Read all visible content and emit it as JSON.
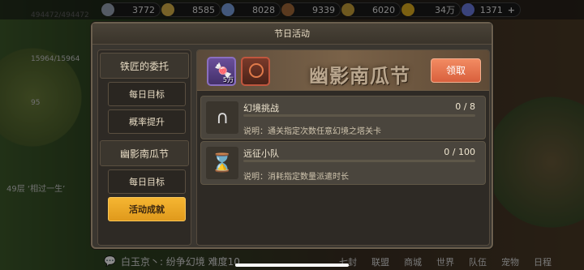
{
  "topbar": {
    "resources": [
      {
        "name": "gem-resource",
        "value": "3772",
        "color": "#9aa4b6"
      },
      {
        "name": "gold-bar-resource",
        "value": "8585",
        "color": "#d9b24a"
      },
      {
        "name": "flower-resource",
        "value": "8028",
        "color": "#7aa0e0"
      },
      {
        "name": "wood-resource",
        "value": "9339",
        "color": "#a56a3a"
      },
      {
        "name": "coin-pile-resource",
        "value": "6020",
        "color": "#c8a03a"
      },
      {
        "name": "coin-resource",
        "value": "34万",
        "color": "#e0b020"
      },
      {
        "name": "diamond-resource",
        "value": "1371",
        "color": "#6a7ae0",
        "plus": "+"
      }
    ]
  },
  "background": {
    "side_list": [
      "494472/494472",
      "",
      "15964/15964",
      "",
      "95",
      "",
      ""
    ],
    "floor": "49层 ‘相过一生’",
    "chat": "白玉京丶: 纷争幻境 难度10",
    "tabs": [
      "七封",
      "联盟",
      "商城",
      "世界",
      "队伍",
      "宠物",
      "日程"
    ]
  },
  "panel": {
    "title": "节日活动",
    "nav": {
      "group1": "铁匠的委托",
      "group1_items": [
        "每日目标",
        "概率提升"
      ],
      "group2": "幽影南瓜节",
      "group2_items": [
        "每日目标",
        "活动成就"
      ]
    },
    "banner": {
      "title": "幽影南瓜节",
      "reward1_qty": "5万",
      "claim_label": "领取"
    },
    "tasks": [
      {
        "name": "幻境挑战",
        "progress_text": "0 / 8",
        "progress": 0,
        "desc": "说明：通关指定次数任意幻境之塔关卡",
        "icon": "horseshoe-icon"
      },
      {
        "name": "远征小队",
        "progress_text": "0 / 100",
        "progress": 0,
        "desc": "说明：消耗指定数量派遣时长",
        "icon": "hourglass-icon"
      }
    ]
  }
}
